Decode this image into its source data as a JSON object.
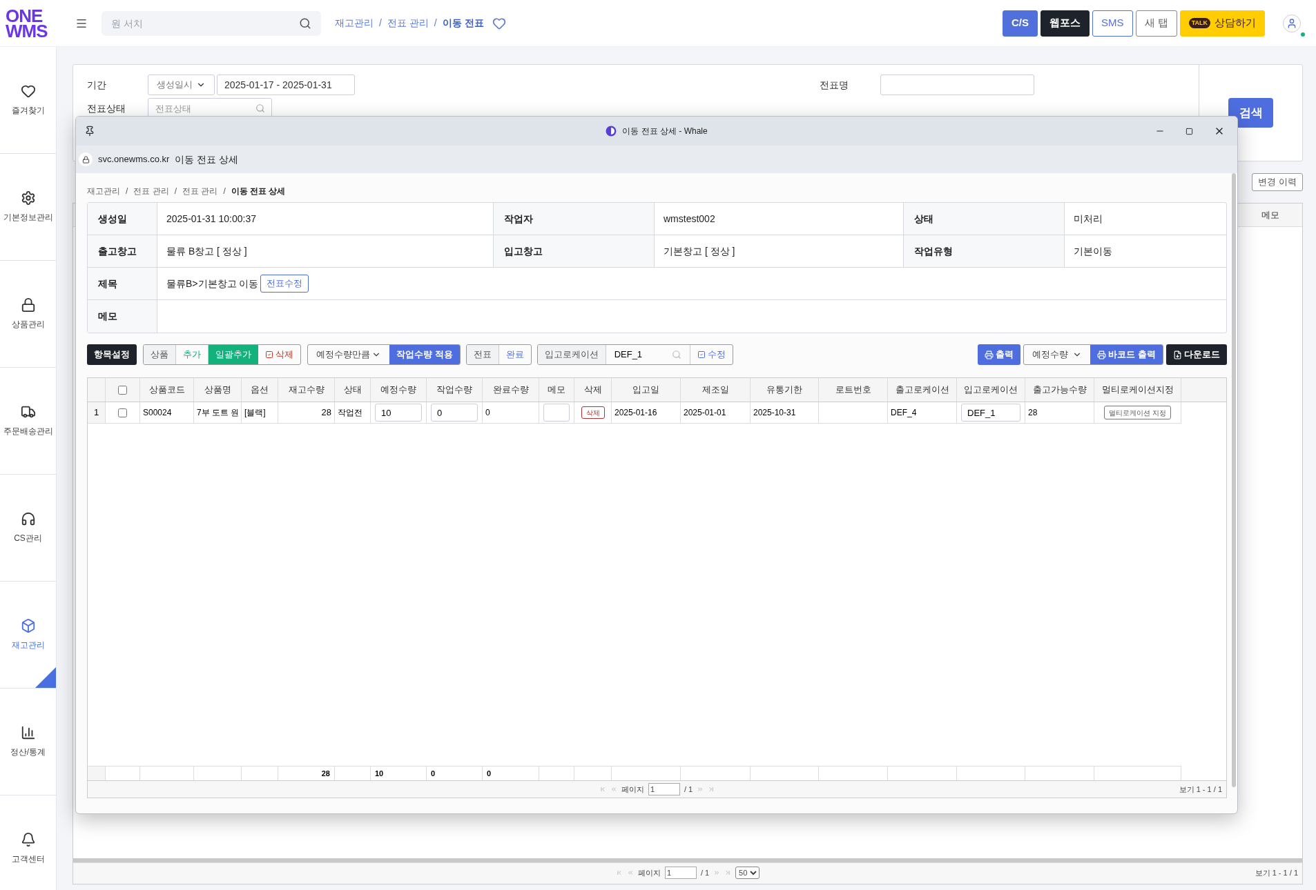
{
  "logo": {
    "line_1": "ONE",
    "line_2": "WMS"
  },
  "search": {
    "placeholder": "원 서치"
  },
  "breadcrumb": [
    {
      "label": "재고관리",
      "current": false
    },
    {
      "separator": "/",
      "label": "전표 관리",
      "current": false
    },
    {
      "separator": "/",
      "label": "이동 전표",
      "current": true
    }
  ],
  "favorite": {
    "on": false
  },
  "header_buttons": [
    {
      "label": "C/S",
      "kind": "primary"
    },
    {
      "label": "웹포스",
      "kind": "dark"
    },
    {
      "label": "SMS",
      "kind": "outline-blue"
    },
    {
      "label": "새 탭",
      "kind": "outline"
    },
    {
      "label": "상담하기",
      "kind": "kakao",
      "badge": "TALK"
    }
  ],
  "user": {
    "online": true
  },
  "sidebar": {
    "items": [
      {
        "label": "즐겨찾기",
        "selected": false
      },
      {
        "label": "기본정보관리",
        "selected": false
      },
      {
        "label": "상품관리",
        "selected": false
      },
      {
        "label": "주문배송관리",
        "selected": false
      },
      {
        "label": "CS관리",
        "selected": false
      },
      {
        "label": "재고관리",
        "selected": true
      },
      {
        "label": "정산/통계",
        "selected": false
      },
      {
        "label": "고객센터",
        "selected": false
      }
    ]
  },
  "filters": {
    "period": {
      "label": "기간",
      "type": "생성일시",
      "range": "2025-01-17 - 2025-01-31"
    },
    "status": {
      "label": "전표상태",
      "placeholder": "전표상태"
    },
    "name": {
      "label": "전표명"
    },
    "search_button": "검색"
  },
  "list_actions": [
    "변경 이력"
  ],
  "list_table": {
    "columns": [
      "메모"
    ]
  },
  "list_pager": {
    "page_label": "페이지",
    "page": "1",
    "total": "/ 1",
    "page_size": "50",
    "summary": "보기 1 - 1 / 1"
  },
  "popup": {
    "window": {
      "title": "이동 전표 상세 - Whale",
      "url": "svc.onewms.co.kr",
      "page_title": "이동 전표 상세"
    },
    "breadcrumb": [
      {
        "label": "재고관리",
        "current": false
      },
      {
        "separator": "/",
        "label": "전표 관리",
        "current": false
      },
      {
        "separator": "/",
        "label": "전표 관리",
        "current": false
      },
      {
        "separator": "/",
        "label": "이동 전표 상세",
        "current": true
      }
    ],
    "info": {
      "rows": [
        [
          {
            "label": "생성일",
            "value": "2025-01-31 10:00:37"
          },
          {
            "label": "작업자",
            "value": "wmstest002"
          },
          {
            "label": "상태",
            "value": "미처리"
          }
        ],
        [
          {
            "label": "출고창고",
            "value": "물류 B창고 [ 정상 ]"
          },
          {
            "label": "입고창고",
            "value": "기본창고 [ 정상 ]"
          },
          {
            "label": "작업유형",
            "value": "기본이동"
          }
        ],
        [
          {
            "label": "제목",
            "value": "물류B>기본창고 이동",
            "action": "전표수정"
          }
        ],
        [
          {
            "label": "메모"
          }
        ]
      ]
    },
    "toolbar": {
      "settings": "항목설정",
      "product": {
        "label": "상품",
        "add": "추가",
        "bulk_add": "일괄추가",
        "delete": "삭제"
      },
      "apply": {
        "option": "예정수량만큼",
        "button": "작업수량 적용"
      },
      "slip": {
        "label": "전표",
        "complete": "완료"
      },
      "location": {
        "label": "입고로케이션",
        "value": "DEF_1",
        "edit": "수정"
      },
      "print": "출력",
      "barcode": {
        "option": "예정수량",
        "button": "바코드 출력"
      },
      "download": "다운로드"
    },
    "grid": {
      "columns": [
        {
          "kind": "blank"
        },
        {
          "kind": "checkbox",
          "checked": false
        },
        {
          "kind": "text",
          "label": "상품코드"
        },
        {
          "kind": "text",
          "label": "상품명"
        },
        {
          "kind": "text",
          "label": "옵션"
        },
        {
          "kind": "text",
          "label": "재고수량"
        },
        {
          "kind": "text",
          "label": "상태"
        },
        {
          "kind": "text",
          "label": "예정수량"
        },
        {
          "kind": "text",
          "label": "작업수량"
        },
        {
          "kind": "text",
          "label": "완료수량"
        },
        {
          "kind": "text",
          "label": "메모"
        },
        {
          "kind": "text",
          "label": "삭제"
        },
        {
          "kind": "text",
          "label": "입고일"
        },
        {
          "kind": "text",
          "label": "제조일"
        },
        {
          "kind": "text",
          "label": "유통기한"
        },
        {
          "kind": "text",
          "label": "로트번호"
        },
        {
          "kind": "text",
          "label": "출고로케이션"
        },
        {
          "kind": "text",
          "label": "입고로케이션"
        },
        {
          "kind": "text",
          "label": "출고가능수량"
        },
        {
          "kind": "text",
          "label": "멀티로케이션지정"
        }
      ],
      "rows": [
        {
          "cells": [
            {
              "kind": "index",
              "value": "1"
            },
            {
              "kind": "checkbox",
              "checked": false
            },
            {
              "kind": "text",
              "value": "S00024"
            },
            {
              "kind": "text",
              "value": "7부 도트 원"
            },
            {
              "kind": "text",
              "value": "[블랙]"
            },
            {
              "kind": "number",
              "value": "28"
            },
            {
              "kind": "text",
              "value": "작업전"
            },
            {
              "kind": "input",
              "value": "10"
            },
            {
              "kind": "input",
              "value": "0"
            },
            {
              "kind": "text",
              "value": "0"
            },
            {
              "kind": "input"
            },
            {
              "kind": "delete",
              "value": "삭제"
            },
            {
              "kind": "text",
              "value": "2025-01-16"
            },
            {
              "kind": "text",
              "value": "2025-01-01"
            },
            {
              "kind": "text",
              "value": "2025-10-31"
            },
            {
              "kind": "blank"
            },
            {
              "kind": "text",
              "value": "DEF_4"
            },
            {
              "kind": "input",
              "value": "DEF_1"
            },
            {
              "kind": "text",
              "value": "28"
            },
            {
              "kind": "button",
              "value": "멀티로케이션 지정"
            }
          ]
        }
      ],
      "totals": [
        {
          "kind": "blank"
        },
        {
          "kind": "blank"
        },
        {
          "kind": "blank"
        },
        {
          "kind": "blank"
        },
        {
          "kind": "blank"
        },
        {
          "kind": "number",
          "value": "28"
        },
        {
          "kind": "blank"
        },
        {
          "kind": "text",
          "value": "10"
        },
        {
          "kind": "text",
          "value": "0"
        },
        {
          "kind": "text",
          "value": "0"
        },
        {
          "kind": "blank"
        },
        {
          "kind": "blank"
        },
        {
          "kind": "blank"
        },
        {
          "kind": "blank"
        },
        {
          "kind": "blank"
        },
        {
          "kind": "blank"
        },
        {
          "kind": "blank"
        },
        {
          "kind": "blank"
        },
        {
          "kind": "blank"
        },
        {
          "kind": "blank"
        }
      ],
      "pager": {
        "page_label": "페이지",
        "page": "1",
        "total": "/ 1",
        "summary": "보기 1 - 1 / 1"
      }
    }
  }
}
